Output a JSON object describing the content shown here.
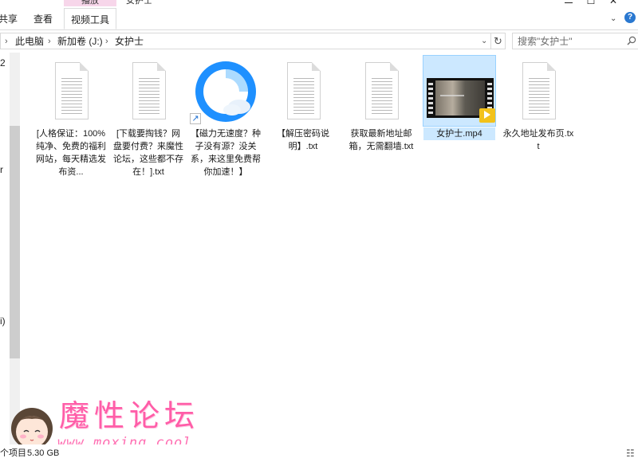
{
  "window": {
    "context_tab_label": "播放",
    "title": "女护士",
    "min_glyph": "",
    "max_glyph": "☐",
    "close_glyph": "✕"
  },
  "ribbon": {
    "tabs": [
      {
        "label": "共享"
      },
      {
        "label": "查看"
      },
      {
        "label": "视频工具"
      }
    ],
    "expand_icon": "chevron-down-icon",
    "help_label": "?"
  },
  "address": {
    "crumbs": [
      {
        "label": "此电脑"
      },
      {
        "label": "新加卷 (J:)"
      },
      {
        "label": "女护士"
      }
    ],
    "search_placeholder": "搜索\"女护士\""
  },
  "nav_fragments": [
    "2",
    "r",
    "i)"
  ],
  "files": [
    {
      "name": "[人格保证：100%纯净、免费的福利网站，每天精选发布资...",
      "kind": "txt",
      "icon": "text-document-icon"
    },
    {
      "name": "[下载要掏钱？网盘要付费？来魔性论坛，这些都不存在！].txt",
      "kind": "txt",
      "icon": "text-document-icon"
    },
    {
      "name": "【磁力无速度？种子没有源？没关系，来这里免费帮你加速！】",
      "kind": "shortcut",
      "icon": "browser-shortcut-icon"
    },
    {
      "name": "【解压密码说明】.txt",
      "kind": "txt",
      "icon": "text-document-icon"
    },
    {
      "name": "获取最新地址邮箱，无需翻墙.txt",
      "kind": "txt",
      "icon": "text-document-icon"
    },
    {
      "name": "女护士.mp4",
      "kind": "video",
      "icon": "video-file-icon",
      "selected": true
    },
    {
      "name": "永久地址发布页.txt",
      "kind": "txt",
      "icon": "text-document-icon"
    }
  ],
  "status": {
    "items_text": "个项目",
    "size_text": "5.30 GB"
  },
  "watermark": {
    "title": "魔性论坛",
    "url": "www.moxing.cool"
  },
  "colors": {
    "accent_pink": "#ff5da8",
    "selection": "#cce8ff",
    "context_tab": "#f7d6ea"
  }
}
